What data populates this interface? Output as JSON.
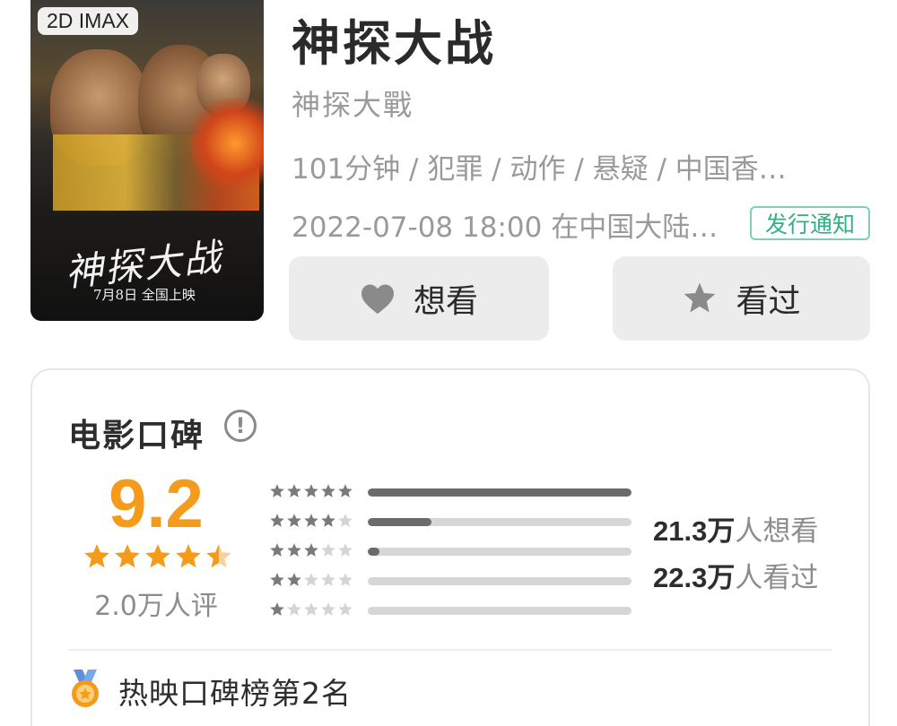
{
  "poster": {
    "format_tag": "2D IMAX",
    "title_art": "神探大战",
    "release_line": "7月8日 全国上映"
  },
  "movie": {
    "title": "神探大战",
    "original_title": "神探大戰",
    "meta": "101分钟 / 犯罪 / 动作 / 悬疑 / 中国香…",
    "release": "2022-07-08 18:00 在中国大陆…",
    "notice_badge": "发行通知"
  },
  "actions": {
    "want_label": "想看",
    "seen_label": "看过"
  },
  "reputation": {
    "title": "电影口碑",
    "info_icon": "!",
    "score": "9.2",
    "score_stars": 4.5,
    "rating_count": "2.0万人评",
    "distribution": [
      {
        "stars": 5,
        "fraction": 1.0
      },
      {
        "stars": 4,
        "fraction": 0.24
      },
      {
        "stars": 3,
        "fraction": 0.045
      },
      {
        "stars": 2,
        "fraction": 0.0
      },
      {
        "stars": 1,
        "fraction": 0.0
      }
    ],
    "want_number": "21.3",
    "want_unit": "万",
    "want_label": "人想看",
    "seen_number": "22.3",
    "seen_unit": "万",
    "seen_label": "人看过",
    "rank_text": "热映口碑榜第2名"
  },
  "colors": {
    "accent_orange": "#f59b1b",
    "notice_green": "#33b082",
    "bar_fill": "#6b6b6b",
    "bar_track": "#d6d6d6"
  },
  "icons": {
    "want": "heart-icon",
    "seen": "star-icon",
    "info": "info-icon",
    "rank": "medal-icon"
  }
}
